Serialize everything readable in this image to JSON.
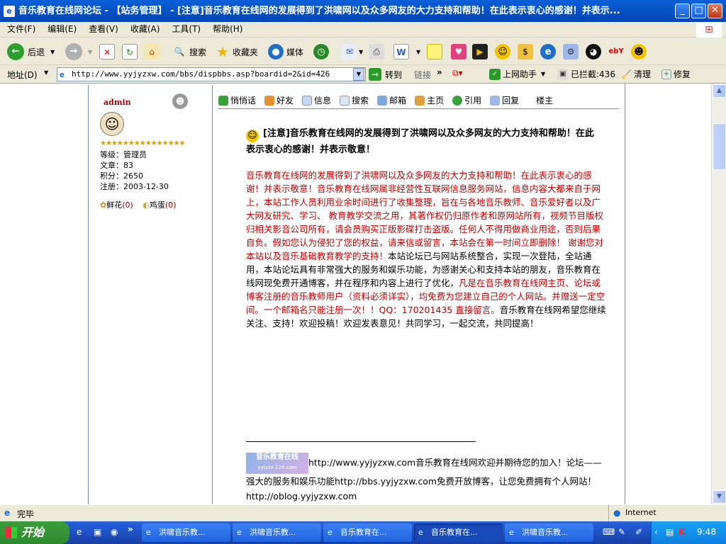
{
  "window": {
    "title": "音乐教育在线网论坛 - 【站务管理】 - [注意]音乐教育在线网的发展得到了洪啸网以及众多网友的大力支持和帮助！在此表示衷心的感谢！并表示..."
  },
  "menu": [
    "文件(F)",
    "编辑(E)",
    "查看(V)",
    "收藏(A)",
    "工具(T)",
    "帮助(H)"
  ],
  "toolbar": {
    "back": "后退",
    "search": "搜索",
    "favorites": "收藏夹",
    "media": "媒体"
  },
  "address": {
    "label": "地址(D)",
    "url": "http://www.yyjyzxw.com/bbs/dispbbs.asp?boardid=2&id=426",
    "go": "转到",
    "links": "链接",
    "helper": "上网助手",
    "blocked": "已拦截:436",
    "clean": "清理",
    "repair": "修复"
  },
  "user": {
    "name": "admin",
    "level": "等级：管理员",
    "posts": "文章：83",
    "points": "积分：2650",
    "registered": "注册：2003-12-30",
    "flowers_label": "鲜花",
    "flowers": "(0)",
    "eggs_label": "鸡蛋",
    "eggs": "(0)",
    "stars": "★★★★★★★★★★★★★★★"
  },
  "post_actions": [
    "悄悄话",
    "好友",
    "信息",
    "搜索",
    "邮箱",
    "主页",
    "引用",
    "回复"
  ],
  "post_floor": "楼主",
  "post": {
    "title": "[注意]音乐教育在线网的发展得到了洪啸网以及众多网友的大力支持和帮助！在此表示衷心的感谢！并表示敬意！",
    "red1": "音乐教育在线网的发展得到了洪啸网以及众多网友的大力支持和帮助！在此表示衷心的感谢！并表示敬意！音乐教育在线网属非经营性互联网信息服务网站，信息内容大都来自于网上，本站工作人员利用业余时间进行了收集整理，旨在与各地音乐教师、音乐爱好者以及广大网友研究、学习、 教育教学交流之用，其著作权仍归原作者和原网站所有，视频节目版权归相关影音公司所有，请会员购买正版影碟打击盗版。任何人不得用做商业用途，否则后果自负。假如您认为侵犯了您的权益，请来信或留言，本站会在第一时间立即删除！ 谢谢您对本站以及音乐基础教育教学的支持！",
    "black1": "本站论坛已与网站系统整合，实现一次登陆，全站通用，本站论坛具有非常强大的服务和娱乐功能，为感谢关心和支持本站的朋友，音乐教育在线网现免费开通博客，并在程序和内容上进行了优化，",
    "red2": "凡是在音乐教育在线网主页、论坛或博客注册的音乐教师用户（资料必须详实），均免费为您建立自己的个人网站。并赠送一定空间。一个邮箱名只能注册一次！！QQ：170201435 直接留言。",
    "black2": "音乐教育在线网希望您继续关注、支持！欢迎投稿！欢迎发表意见！共同学习，一起交流，共同提高！"
  },
  "signature": {
    "logo_text": "音乐教育在线",
    "logo_sub": "yyjyzx.126.com",
    "line": "http://www.yyjyzxw.com音乐教育在线网欢迎并期待您的加入！论坛——强大的服务和娱乐功能http://bbs.yyjyzxw.com免费开放博客，让您免费拥有个人网站！http://oblog.yyjyzxw.com"
  },
  "status": {
    "text": "完毕",
    "zone": "Internet"
  },
  "taskbar": {
    "start": "开始",
    "buttons": [
      "洪啸音乐教...",
      "洪啸音乐教...",
      "音乐教育在...",
      "音乐教育在...",
      "洪啸音乐教..."
    ],
    "clock": "9:48"
  }
}
